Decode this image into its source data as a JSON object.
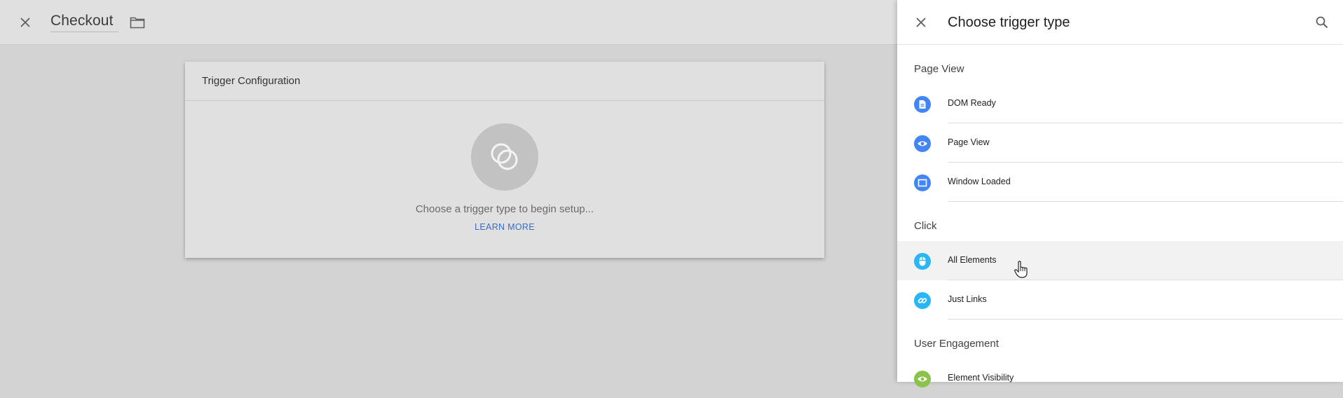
{
  "editor": {
    "title": "Checkout",
    "card": {
      "title": "Trigger Configuration",
      "hint": "Choose a trigger type to begin setup...",
      "learn_more": "LEARN MORE"
    }
  },
  "panel": {
    "title": "Choose trigger type",
    "sections": [
      {
        "title": "Page View",
        "items": [
          {
            "label": "DOM Ready",
            "icon": "document-icon",
            "color": "#4285f4"
          },
          {
            "label": "Page View",
            "icon": "eye-icon",
            "color": "#4285f4"
          },
          {
            "label": "Window Loaded",
            "icon": "window-icon",
            "color": "#4285f4"
          }
        ]
      },
      {
        "title": "Click",
        "items": [
          {
            "label": "All Elements",
            "icon": "mouse-icon",
            "color": "#29b6f6"
          },
          {
            "label": "Just Links",
            "icon": "link-icon",
            "color": "#29b6f6"
          }
        ]
      },
      {
        "title": "User Engagement",
        "items": [
          {
            "label": "Element Visibility",
            "icon": "eye-icon",
            "color": "#8bc34a"
          }
        ]
      }
    ]
  },
  "colors": {
    "page_view_accent": "#4285f4",
    "click_accent": "#29b6f6",
    "engagement_accent": "#8bc34a",
    "link": "#3a6cc4"
  }
}
